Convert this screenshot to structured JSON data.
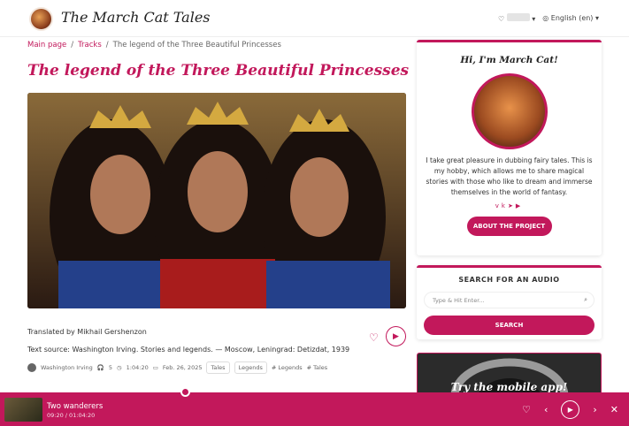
{
  "header": {
    "site_title": "The March Cat Tales",
    "language": "English (en)"
  },
  "breadcrumb": [
    "Main page",
    "Tracks",
    "The legend of the Three Beautiful Princesses"
  ],
  "article": {
    "title": "The legend of the Three Beautiful Princesses",
    "translated_by": "Translated by Mikhail Gershenzon",
    "text_source": "Text source: Washington Irving. Stories and legends. — Moscow, Leningrad: Detizdat, 1939",
    "author": "Washington Irving",
    "listens": "5",
    "duration": "1:04:20",
    "date": "Feb. 26, 2025",
    "tags": [
      "Tales",
      "Legends",
      "# Legends",
      "# Tales"
    ]
  },
  "sidebar": {
    "greeting": "Hi, I'm March Cat!",
    "about_text": "I take great pleasure in dubbing fairy tales. This is my hobby, which allows me to share magical stories with those who like to dream and immerse themselves in the world of fantasy.",
    "about_button": "ABOUT THE PROJECT",
    "search_heading": "SEARCH FOR AN AUDIO",
    "search_placeholder": "Type & Hit Enter...",
    "search_button": "SEARCH",
    "promo_text": "Try the mobile app!"
  },
  "player": {
    "title": "Two wanderers",
    "time": "09:20 / 01:04:20",
    "progress": 0.29
  },
  "colors": {
    "accent": "#c2185b"
  }
}
